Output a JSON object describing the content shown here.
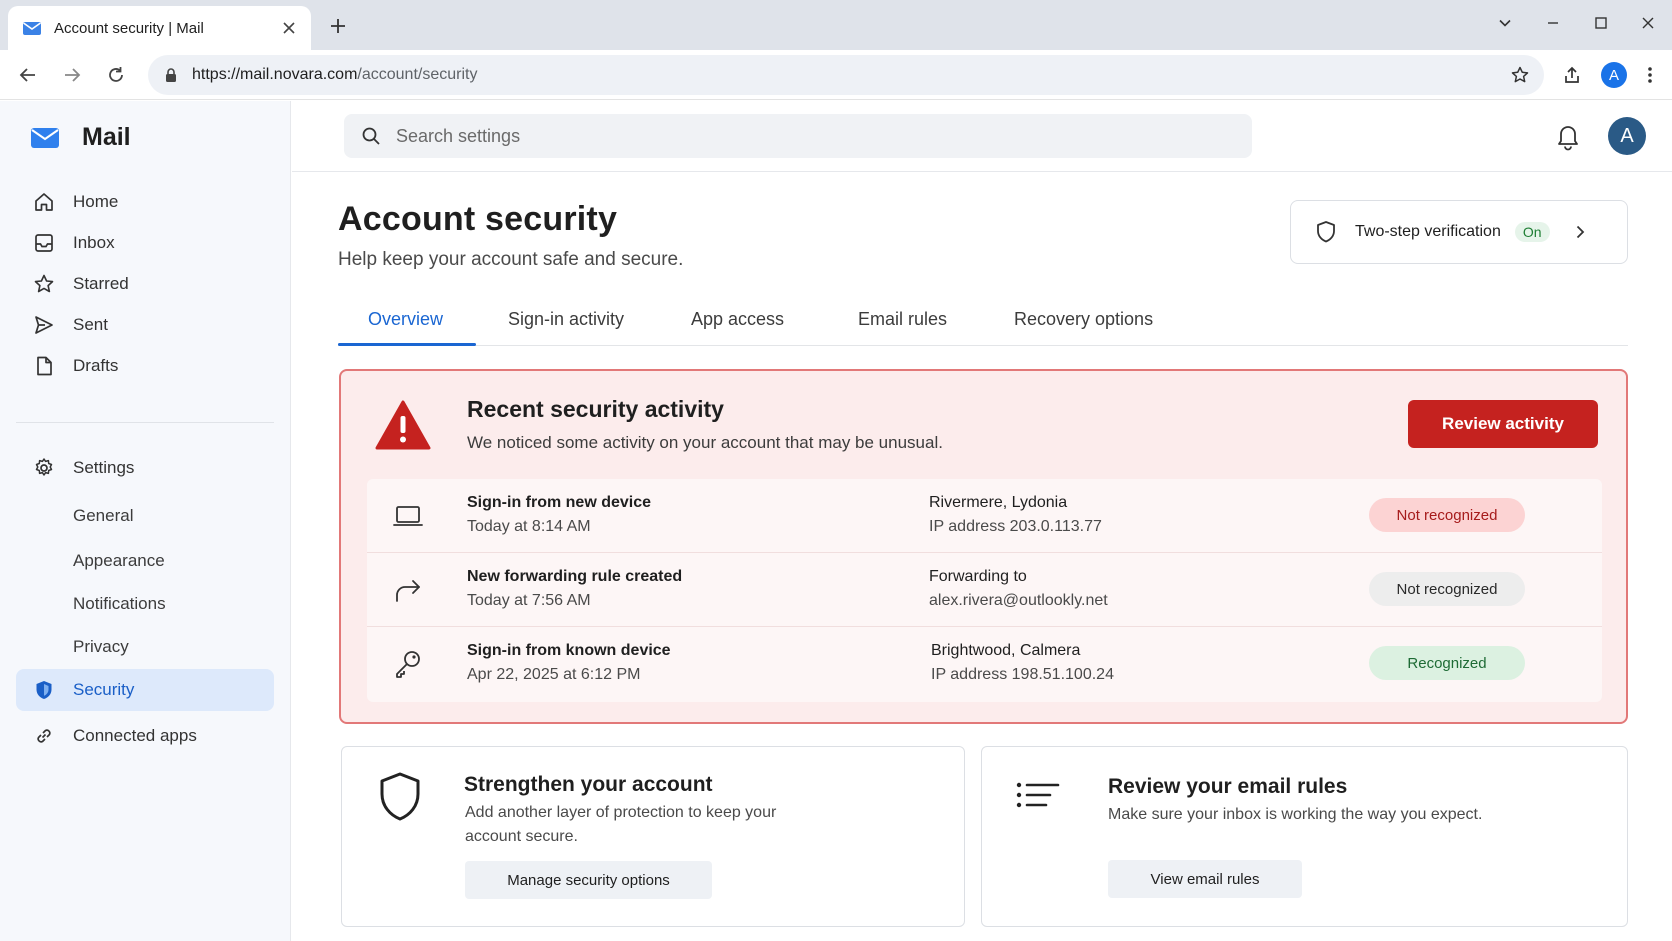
{
  "browser": {
    "tab_title": "Account security | Mail",
    "url_host": "https://mail.novara.com",
    "url_path": "/account/security",
    "profile_initial": "A"
  },
  "app": {
    "name": "Mail",
    "search_placeholder": "Search settings",
    "avatar_initial": "A",
    "accent_color": "#1a66d2",
    "danger_color": "#c5221f"
  },
  "sidebar": {
    "items": [
      {
        "label": "Home",
        "icon": "home-icon"
      },
      {
        "label": "Inbox",
        "icon": "inbox-icon"
      },
      {
        "label": "Starred",
        "icon": "star-icon"
      },
      {
        "label": "Sent",
        "icon": "send-icon"
      },
      {
        "label": "Drafts",
        "icon": "draft-icon"
      }
    ],
    "settings_label": "Settings",
    "sub_items": [
      "General",
      "Appearance",
      "Notifications",
      "Privacy"
    ],
    "security_label": "Security",
    "connected_label": "Connected apps",
    "active": "Security"
  },
  "page": {
    "title": "Account security",
    "subtitle": "Help keep your account safe and secure.",
    "two_step": {
      "label": "Two-step verification",
      "status": "On"
    },
    "tabs": [
      "Overview",
      "Sign-in activity",
      "App access",
      "Email rules",
      "Recovery options"
    ],
    "active_tab": "Overview"
  },
  "alert": {
    "title": "Recent security activity",
    "description": "We noticed some activity on your account that may be unusual.",
    "button": "Review activity",
    "events": [
      {
        "icon": "laptop-icon",
        "title": "Sign-in from new device",
        "time": "Today at 8:14 AM",
        "detail1": "Rivermere, Lydonia",
        "detail2": "IP address 203.0.113.77",
        "status": "Not recognized",
        "status_tone": "red"
      },
      {
        "icon": "forward-arrow-icon",
        "title": "New forwarding rule created",
        "time": "Today at 7:56 AM",
        "detail1": "Forwarding to",
        "detail2": "alex.rivera@outlookly.net",
        "status": "Not recognized",
        "status_tone": "gray"
      },
      {
        "icon": "key-icon",
        "title": "Sign-in from known device",
        "time": "Apr 22, 2025 at 6:12 PM",
        "detail1": "Brightwood, Calmera",
        "detail2": "IP address 198.51.100.24",
        "status": "Recognized",
        "status_tone": "green"
      }
    ]
  },
  "cards": [
    {
      "icon": "shield-icon",
      "title": "Strengthen your account",
      "desc_line1": "Add another layer of protection to keep your",
      "desc_line2": "account secure.",
      "button": "Manage security options"
    },
    {
      "icon": "list-icon",
      "title": "Review your email rules",
      "desc_line1": "Make sure your inbox is working the way you expect.",
      "button": "View email rules"
    }
  ]
}
